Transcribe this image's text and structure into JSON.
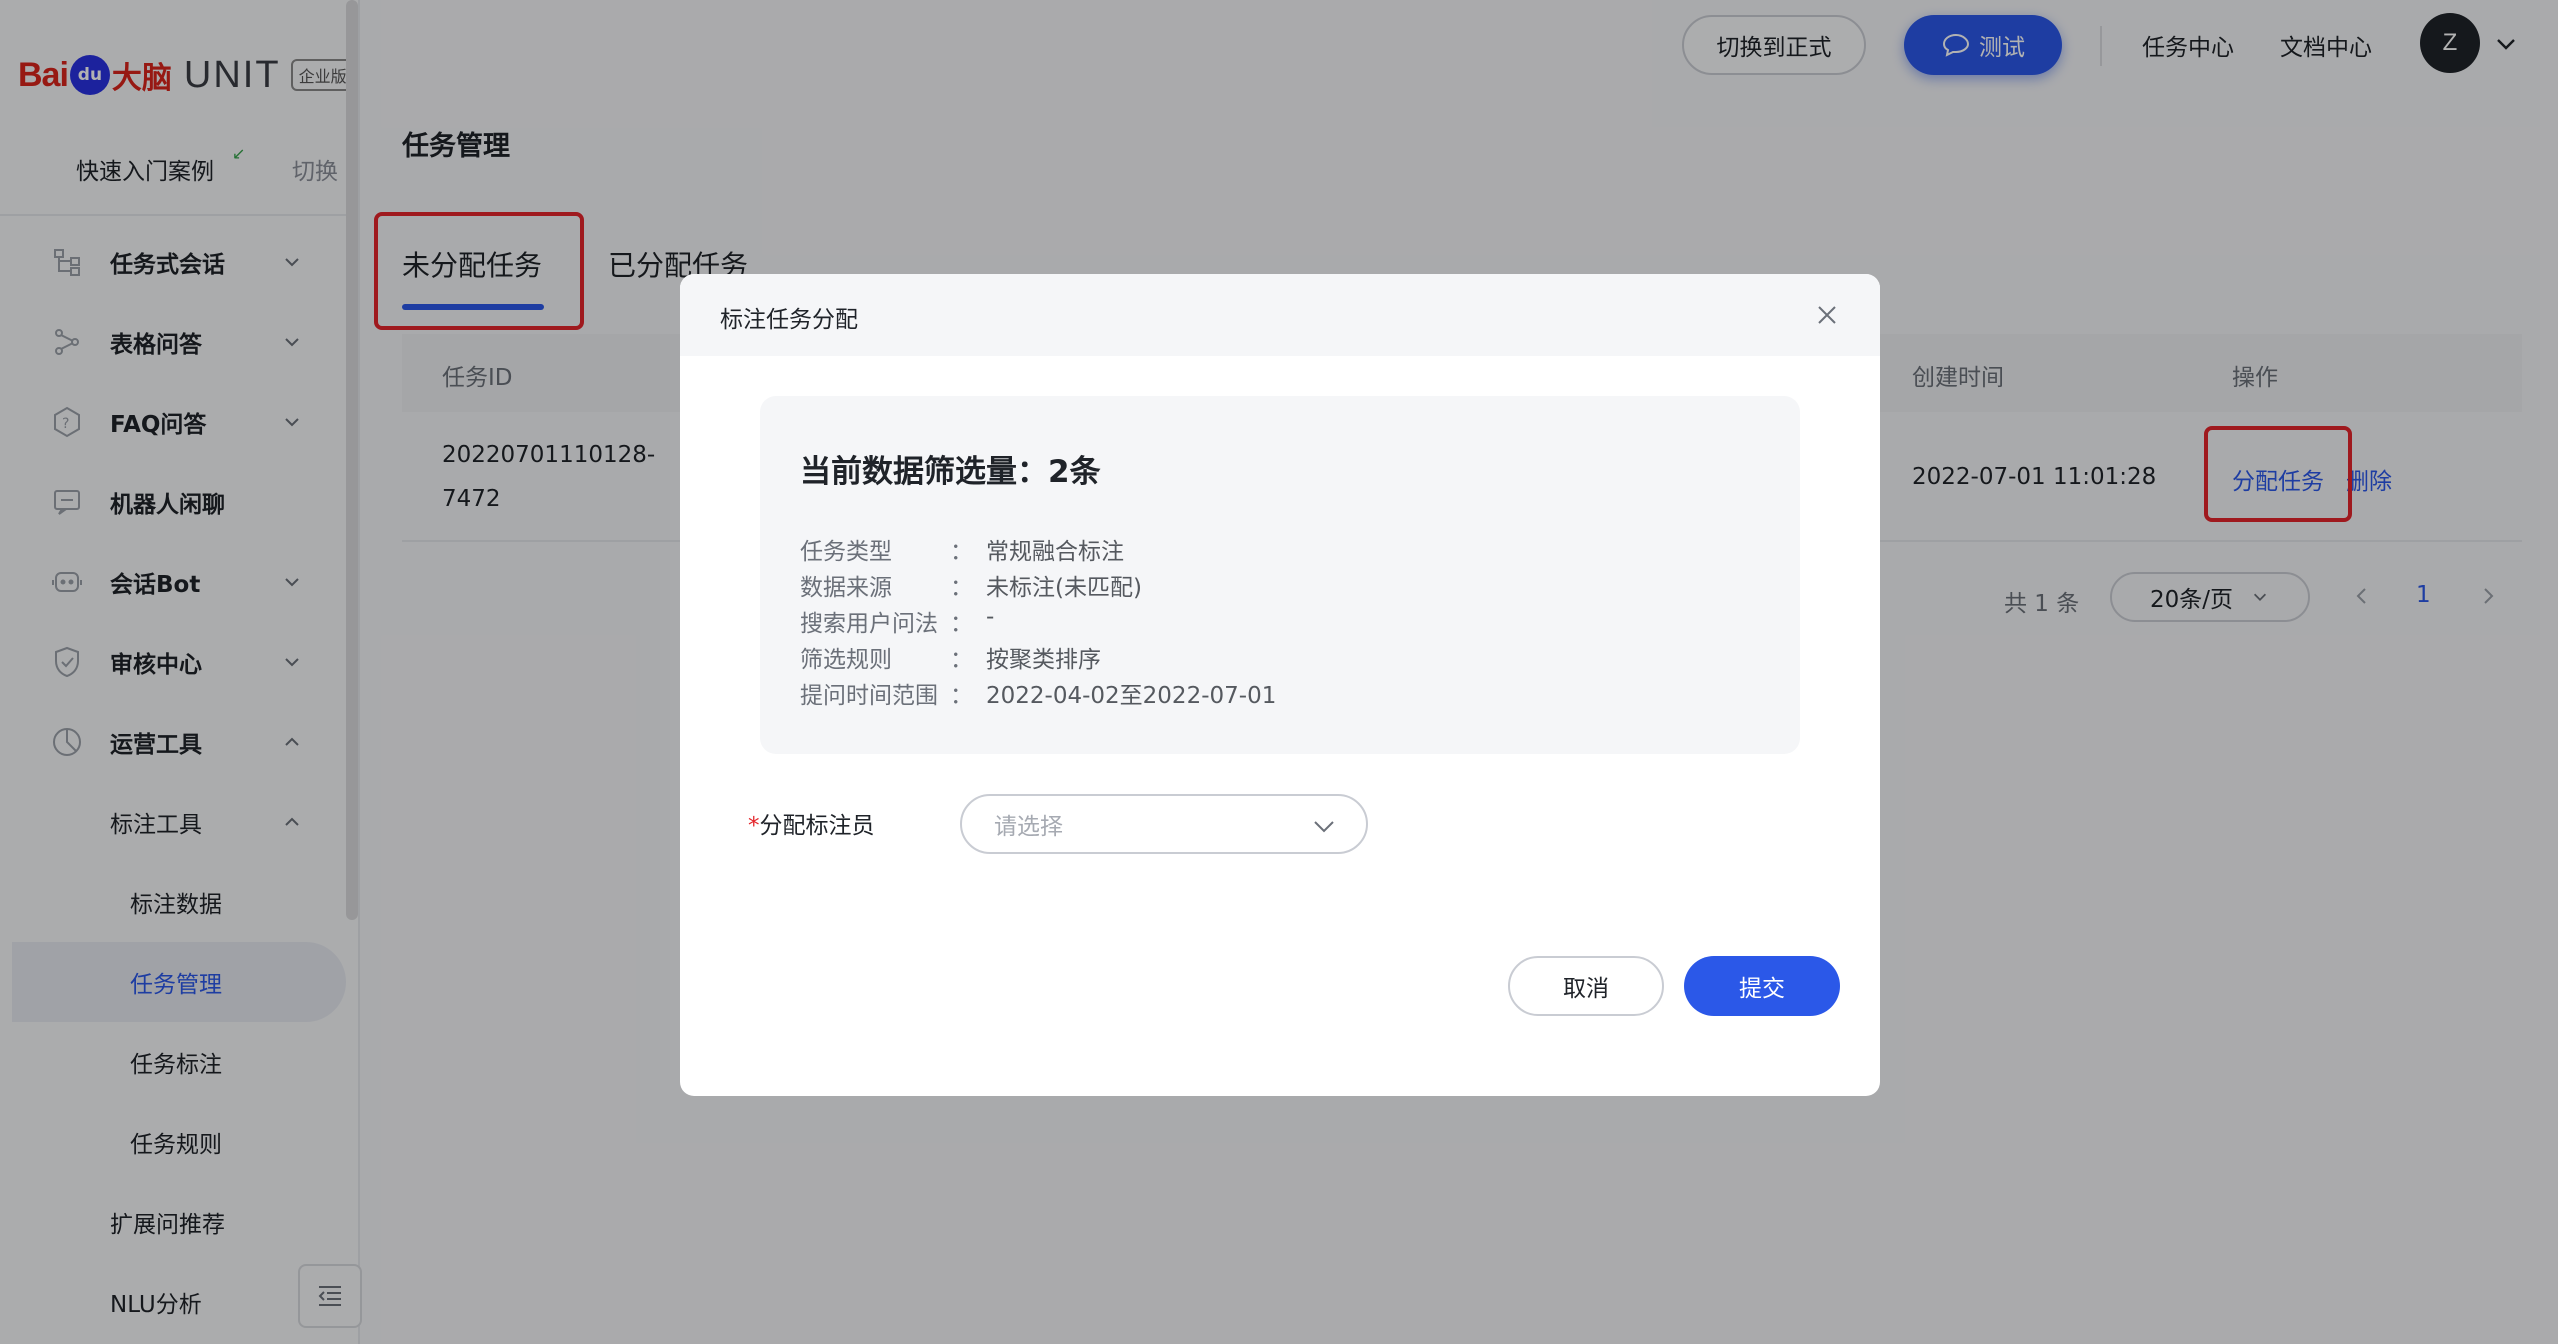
{
  "brand": {
    "logo_bai": "Bai",
    "logo_du": "du",
    "logo_brain": "大脑",
    "product": "UNIT",
    "edition": "企业版"
  },
  "sidebar": {
    "case_title": "快速入门案例",
    "switch_label": "切换",
    "items": [
      {
        "label": "任务式会话",
        "icon": "flow-icon",
        "chevron": "down"
      },
      {
        "label": "表格问答",
        "icon": "table-qa-icon",
        "chevron": "down"
      },
      {
        "label": "FAQ问答",
        "icon": "faq-icon",
        "chevron": "down"
      },
      {
        "label": "机器人闲聊",
        "icon": "chat-icon",
        "chevron": ""
      },
      {
        "label": "会话Bot",
        "icon": "bot-icon",
        "chevron": "down"
      },
      {
        "label": "审核中心",
        "icon": "shield-icon",
        "chevron": "down"
      },
      {
        "label": "运营工具",
        "icon": "ops-icon",
        "chevron": "up"
      },
      {
        "label": "标注工具",
        "chevron": "up"
      },
      {
        "label": "标注数据"
      },
      {
        "label": "任务管理",
        "active": true
      },
      {
        "label": "任务标注"
      },
      {
        "label": "任务规则"
      },
      {
        "label": "扩展问推荐"
      },
      {
        "label": "NLU分析"
      }
    ]
  },
  "topbar": {
    "switch_formal": "切换到正式",
    "test": "测试",
    "task_center": "任务中心",
    "doc_center": "文档中心",
    "avatar": "Z"
  },
  "page": {
    "title": "任务管理",
    "tabs": [
      "未分配任务",
      "已分配任务"
    ],
    "active_tab": "未分配任务"
  },
  "table": {
    "columns": [
      "任务ID",
      "创建时间",
      "操作"
    ],
    "rows": [
      {
        "id_line1": "20220701110128-",
        "id_line2": "7472",
        "created": "2022-07-01 11:01:28",
        "ops": [
          "分配任务",
          "删除"
        ]
      }
    ]
  },
  "pagination": {
    "total": "共 1 条",
    "page_size": "20条/页",
    "current": "1"
  },
  "modal": {
    "title": "标注任务分配",
    "count_label": "当前数据筛选量：",
    "count_value": "2条",
    "info": [
      {
        "key": "任务类型",
        "value": "常规融合标注"
      },
      {
        "key": "数据来源",
        "value": "未标注(未匹配)"
      },
      {
        "key": "搜索用户问法",
        "value": "-"
      },
      {
        "key": "筛选规则",
        "value": "按聚类排序"
      },
      {
        "key": "提问时间范围",
        "value": "2022-04-02至2022-07-01"
      }
    ],
    "separator": "：",
    "field_required": "*",
    "field_label": "分配标注员",
    "select_placeholder": "请选择",
    "cancel": "取消",
    "submit": "提交"
  },
  "colors": {
    "accent": "#2b58e8",
    "highlight": "#e4252b"
  }
}
